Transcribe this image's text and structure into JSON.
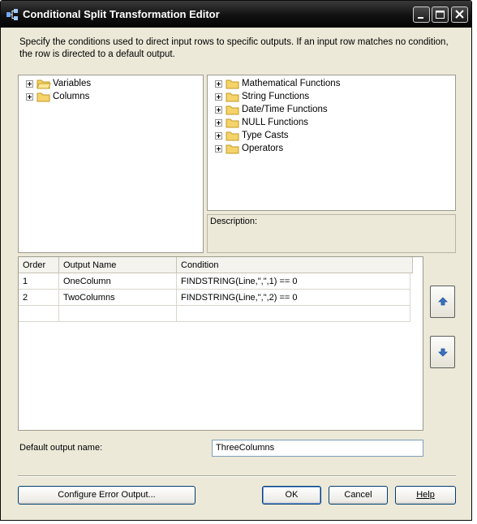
{
  "window": {
    "title": "Conditional Split Transformation Editor"
  },
  "intro_text": "Specify the conditions used to direct input rows to specific outputs. If an input row matches no condition, the row is directed to a default output.",
  "left_tree": [
    {
      "label": "Variables"
    },
    {
      "label": "Columns"
    }
  ],
  "right_tree": [
    {
      "label": "Mathematical Functions"
    },
    {
      "label": "String Functions"
    },
    {
      "label": "Date/Time Functions"
    },
    {
      "label": "NULL Functions"
    },
    {
      "label": "Type Casts"
    },
    {
      "label": "Operators"
    }
  ],
  "description": {
    "label": "Description:",
    "text": ""
  },
  "grid": {
    "columns": [
      "Order",
      "Output Name",
      "Condition"
    ],
    "rows": [
      {
        "order": "1",
        "name": "OneColumn",
        "condition": "FINDSTRING(Line,\",\",1) == 0"
      },
      {
        "order": "2",
        "name": "TwoColumns",
        "condition": "FINDSTRING(Line,\",\",2) == 0"
      },
      {
        "order": "",
        "name": "",
        "condition": ""
      }
    ]
  },
  "default_output": {
    "label": "Default output name:",
    "value": "ThreeColumns"
  },
  "buttons": {
    "configure_error": "Configure Error Output...",
    "ok": "OK",
    "cancel": "Cancel",
    "help": "Help"
  },
  "colors": {
    "title_bar": "#111111",
    "dialog_background": "#ece9d8",
    "button_border": "#003c74",
    "folder": "#f5d36a",
    "arrow": "#3a73c5"
  },
  "icons": {
    "app": "transformation-editor-icon",
    "minimize": "minimize-icon",
    "maximize": "maximize-icon",
    "close": "close-icon",
    "folder": "folder-icon",
    "expander": "plus-expander-icon",
    "move_up": "arrow-up-icon",
    "move_down": "arrow-down-icon"
  }
}
